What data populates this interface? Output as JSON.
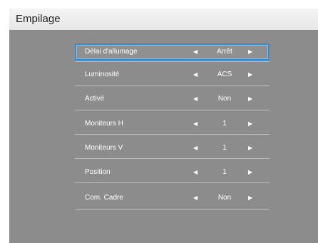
{
  "menu": {
    "title": "Empilage",
    "items": [
      {
        "label": "Délai d'allumage",
        "value": "Arrêt",
        "left_arrow": "◀",
        "right_arrow": "▶",
        "selected": true
      },
      {
        "label": "Luminosité",
        "value": "ACS",
        "left_arrow": "◀",
        "right_arrow": "▶",
        "selected": false
      },
      {
        "label": "Activé",
        "value": "Non",
        "left_arrow": "◀",
        "right_arrow": "▶",
        "selected": false
      },
      {
        "label": "Moniteurs H",
        "value": "1",
        "left_arrow": "◀",
        "right_arrow": "▶",
        "selected": false
      },
      {
        "label": "Moniteurs V",
        "value": "1",
        "left_arrow": "◀",
        "right_arrow": "▶",
        "selected": false
      },
      {
        "label": "Position",
        "value": "1",
        "left_arrow": "◀",
        "right_arrow": "▶",
        "selected": false
      },
      {
        "label": "Com. Cadre",
        "value": "Non",
        "left_arrow": "◀",
        "right_arrow": "▶",
        "selected": false
      }
    ]
  },
  "colors": {
    "panel": "#8c8c8c",
    "header": "#eeeeee",
    "selection_border": "#2f8fd8",
    "text": "#ffffff"
  }
}
